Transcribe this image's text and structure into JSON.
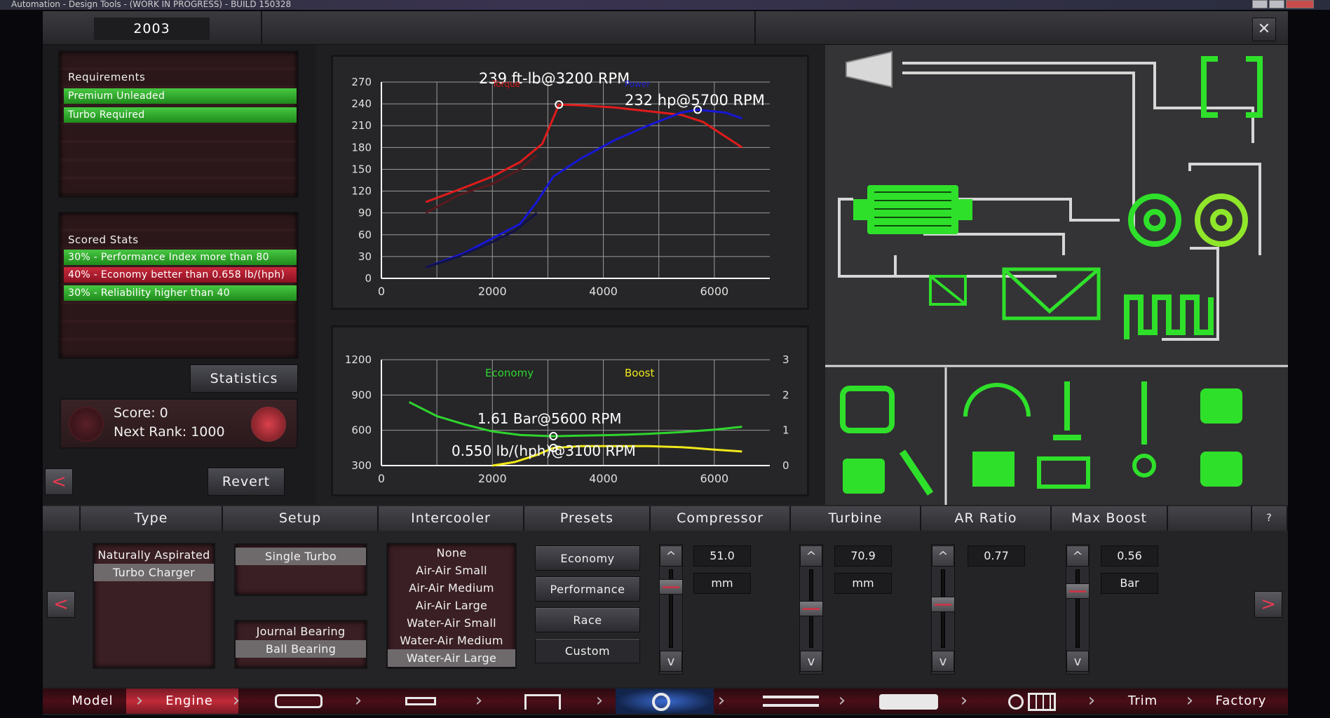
{
  "window": {
    "title": "Automation - Design Tools - (WORK IN PROGRESS) - BUILD 150328"
  },
  "header": {
    "year": "2003",
    "close": "✕"
  },
  "requirements": {
    "title": "Requirements",
    "items": [
      "Premium Unleaded",
      "Turbo Required"
    ]
  },
  "scored": {
    "title": "Scored Stats",
    "items": [
      {
        "text": "30% - Performance Index more than 80",
        "status": "pass"
      },
      {
        "text": "40% - Economy better than 0.658 lb/(hph)",
        "status": "fail"
      },
      {
        "text": "30% - Reliability higher than 40",
        "status": "pass"
      }
    ]
  },
  "statistics_button": "Statistics",
  "score": {
    "score_text": "Score: 0",
    "rank_text": "Next Rank: 1000"
  },
  "revert_button": "Revert",
  "torque_chart": {
    "torque_label": "239 ft-lb@3200 RPM",
    "power_label": "232 hp@5700 RPM",
    "series_torque_tag": "Torque",
    "series_power_tag": "Power",
    "y_ticks": [
      "270",
      "240",
      "210",
      "180",
      "150",
      "120",
      "90",
      "60",
      "30",
      "0"
    ],
    "x_ticks": [
      "0",
      "2000",
      "4000",
      "6000"
    ]
  },
  "eco_chart": {
    "economy_tag": "Economy",
    "boost_tag": "Boost",
    "boost_label": "1.61 Bar@5600 RPM",
    "economy_label": "0.550 lb/(hph)@3100 RPM",
    "y_ticks": [
      "1200",
      "900",
      "600",
      "300"
    ],
    "y2_ticks": [
      "3",
      "2",
      "1",
      "0"
    ],
    "x_ticks": [
      "0",
      "2000",
      "4000",
      "6000"
    ]
  },
  "chart_data": [
    {
      "type": "line",
      "xlabel": "",
      "ylabel": "",
      "xlim": [
        0,
        7000
      ],
      "ylim": [
        0,
        270
      ],
      "series": [
        {
          "name": "Torque",
          "color": "#e11b1b",
          "x": [
            800,
            1500,
            2000,
            2500,
            2900,
            3200,
            3600,
            4200,
            4800,
            5400,
            5800,
            6200,
            6500
          ],
          "y": [
            105,
            125,
            140,
            160,
            185,
            239,
            238,
            235,
            230,
            225,
            215,
            195,
            180
          ]
        },
        {
          "name": "Power",
          "color": "#1717d6",
          "x": [
            800,
            1500,
            2000,
            2500,
            2800,
            3100,
            3600,
            4200,
            4800,
            5400,
            5700,
            6200,
            6500
          ],
          "y": [
            15,
            35,
            55,
            75,
            105,
            140,
            165,
            190,
            210,
            228,
            232,
            228,
            220
          ]
        },
        {
          "color": "#5a1a1e",
          "x": [
            800,
            1400,
            2000,
            2500,
            2800
          ],
          "y": [
            90,
            115,
            130,
            150,
            170
          ]
        },
        {
          "color": "#12124a",
          "x": [
            800,
            1400,
            2000,
            2400,
            2800
          ],
          "y": [
            15,
            30,
            50,
            65,
            90
          ]
        }
      ]
    },
    {
      "type": "line",
      "xlabel": "",
      "ylabel": "",
      "xlim": [
        0,
        7000
      ],
      "ylim": [
        300,
        1200
      ],
      "y2lim": [
        0,
        3
      ],
      "series": [
        {
          "name": "Economy",
          "color": "#2ed52e",
          "x": [
            500,
            1000,
            1500,
            2000,
            2500,
            3100,
            3600,
            4200,
            4800,
            5400,
            6000,
            6500
          ],
          "y": [
            840,
            720,
            650,
            590,
            560,
            550,
            555,
            560,
            570,
            585,
            605,
            630
          ]
        },
        {
          "name": "Boost",
          "color": "#f0e81a",
          "axis": "y2",
          "x": [
            2000,
            2400,
            2800,
            3100,
            3600,
            4200,
            4800,
            5400,
            5600,
            6000,
            6500
          ],
          "y": [
            0.0,
            0.1,
            0.3,
            0.5,
            0.55,
            0.55,
            0.55,
            0.52,
            0.5,
            0.45,
            0.4
          ]
        }
      ]
    }
  ],
  "columns": {
    "type": "Type",
    "setup": "Setup",
    "intercooler": "Intercooler",
    "presets": "Presets",
    "compressor": "Compressor",
    "turbine": "Turbine",
    "ar": "AR Ratio",
    "maxboost": "Max Boost",
    "help": "?"
  },
  "type_list": [
    "Naturally Aspirated",
    "Turbo Charger"
  ],
  "setup_list": [
    "Single Turbo"
  ],
  "bearing_list": [
    "Journal Bearing",
    "Ball Bearing"
  ],
  "intercooler_list": [
    "None",
    "Air-Air Small",
    "Air-Air Medium",
    "Air-Air Large",
    "Water-Air Small",
    "Water-Air Medium",
    "Water-Air Large"
  ],
  "presets": [
    "Economy",
    "Performance",
    "Race",
    "Custom"
  ],
  "compressor": {
    "value": "51.0",
    "unit": "mm",
    "level": 0.22
  },
  "turbine": {
    "value": "70.9",
    "unit": "mm",
    "level": 0.5
  },
  "ar": {
    "value": "0.77",
    "unit": "",
    "level": 0.45
  },
  "maxboost": {
    "value": "0.56",
    "unit": "Bar",
    "level": 0.28
  },
  "nav": {
    "model": "Model",
    "engine": "Engine",
    "trim": "Trim",
    "factory": "Factory"
  },
  "colors": {
    "green": "#2fe02a",
    "accent_red": "#c52637",
    "panel": "#262628"
  }
}
